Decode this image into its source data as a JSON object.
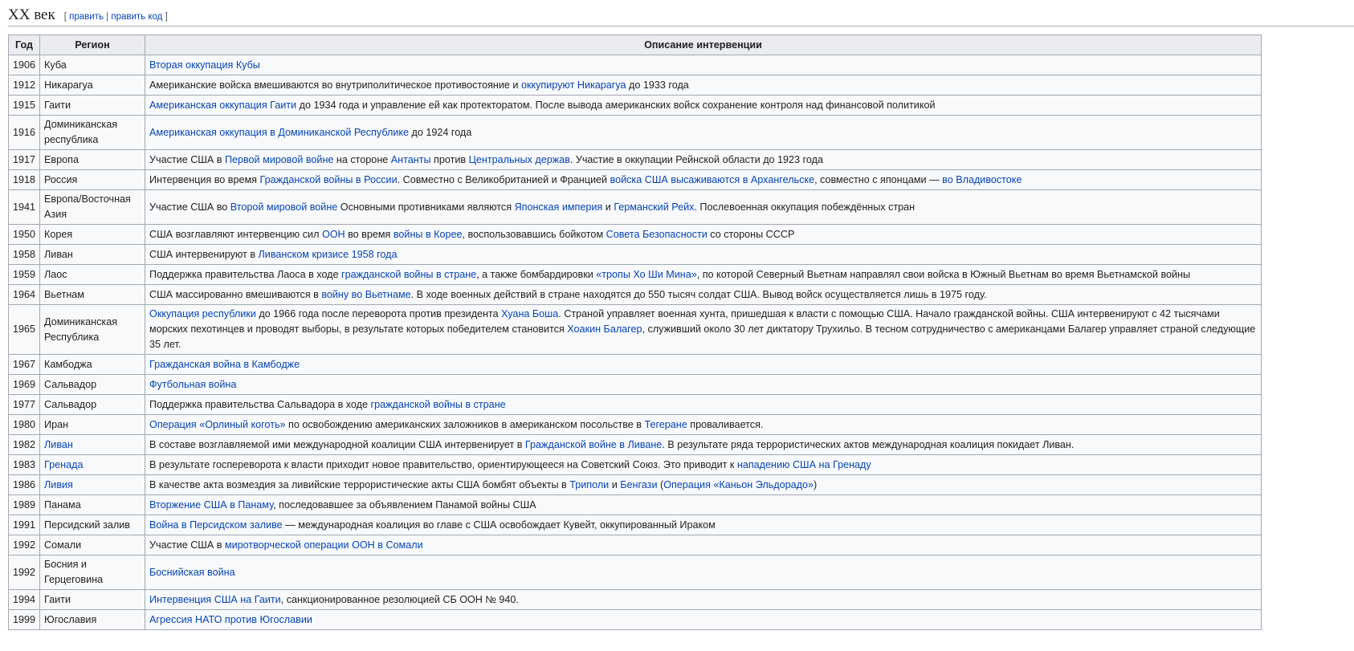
{
  "heading": {
    "title": "XX век",
    "edit_open": "[",
    "edit_label": "править",
    "edit_sep": "|",
    "edit_code_label": "править код",
    "edit_close": "]"
  },
  "table": {
    "headers": [
      "Год",
      "Регион",
      "Описание интервенции"
    ],
    "rows": [
      {
        "year": "1906",
        "region": {
          "text": "Куба",
          "link": false
        },
        "desc": [
          {
            "t": "Вторая оккупация Кубы",
            "l": true
          }
        ]
      },
      {
        "year": "1912",
        "region": {
          "text": "Никарагуа",
          "link": false
        },
        "desc": [
          {
            "t": "Американские войска вмешиваются во внутриполитическое противостояние и ",
            "l": false
          },
          {
            "t": "оккупируют Никарагуа",
            "l": true
          },
          {
            "t": " до 1933 года",
            "l": false
          }
        ]
      },
      {
        "year": "1915",
        "region": {
          "text": "Гаити",
          "link": false
        },
        "desc": [
          {
            "t": "Американская оккупация Гаити",
            "l": true
          },
          {
            "t": " до 1934 года и управление ей как протекторатом. После вывода американских войск сохранение контроля над финансовой политикой",
            "l": false
          }
        ]
      },
      {
        "year": "1916",
        "region": {
          "text": "Доминиканская республика",
          "link": false
        },
        "desc": [
          {
            "t": "Американская оккупация в Доминиканской Республике",
            "l": true
          },
          {
            "t": " до 1924 года",
            "l": false
          }
        ]
      },
      {
        "year": "1917",
        "region": {
          "text": "Европа",
          "link": false
        },
        "desc": [
          {
            "t": "Участие США в ",
            "l": false
          },
          {
            "t": "Первой мировой войне",
            "l": true
          },
          {
            "t": " на стороне ",
            "l": false
          },
          {
            "t": "Антанты",
            "l": true
          },
          {
            "t": " против ",
            "l": false
          },
          {
            "t": "Центральных держав",
            "l": true
          },
          {
            "t": ". Участие в оккупации Рейнской области до 1923 года",
            "l": false
          }
        ]
      },
      {
        "year": "1918",
        "region": {
          "text": "Россия",
          "link": false
        },
        "desc": [
          {
            "t": "Интервенция во время ",
            "l": false
          },
          {
            "t": "Гражданской войны в России",
            "l": true
          },
          {
            "t": ". Совместно с Великобританией и Францией ",
            "l": false
          },
          {
            "t": "войска США высаживаются в Архангельске",
            "l": true
          },
          {
            "t": ", совместно с японцами — ",
            "l": false
          },
          {
            "t": "во Владивостоке",
            "l": true
          }
        ]
      },
      {
        "year": "1941",
        "region": {
          "text": "Европа/Восточная Азия",
          "link": false
        },
        "desc": [
          {
            "t": "Участие США во ",
            "l": false
          },
          {
            "t": "Второй мировой войне",
            "l": true
          },
          {
            "t": " Основными противниками являются ",
            "l": false
          },
          {
            "t": "Японская империя",
            "l": true
          },
          {
            "t": " и ",
            "l": false
          },
          {
            "t": "Германский Рейх",
            "l": true
          },
          {
            "t": ". Послевоенная оккупация побеждённых стран",
            "l": false
          }
        ]
      },
      {
        "year": "1950",
        "region": {
          "text": "Корея",
          "link": false
        },
        "desc": [
          {
            "t": "США возглавляют интервенцию сил ",
            "l": false
          },
          {
            "t": "ООН",
            "l": true
          },
          {
            "t": " во время ",
            "l": false
          },
          {
            "t": "войны в Корее",
            "l": true
          },
          {
            "t": ", воспользовавшись бойкотом ",
            "l": false
          },
          {
            "t": "Совета Безопасности",
            "l": true
          },
          {
            "t": " со стороны СССР",
            "l": false
          }
        ]
      },
      {
        "year": "1958",
        "region": {
          "text": "Ливан",
          "link": false
        },
        "desc": [
          {
            "t": "США интервенируют в ",
            "l": false
          },
          {
            "t": "Ливанском кризисе 1958 года",
            "l": true
          }
        ]
      },
      {
        "year": "1959",
        "region": {
          "text": "Лаос",
          "link": false
        },
        "desc": [
          {
            "t": "Поддержка правительства Лаоса в ходе ",
            "l": false
          },
          {
            "t": "гражданской войны в стране",
            "l": true
          },
          {
            "t": ", а также бомбардировки ",
            "l": false
          },
          {
            "t": "«тропы Хо Ши Мина»",
            "l": true
          },
          {
            "t": ", по которой Северный Вьетнам направлял свои войска в Южный Вьетнам во время Вьетнамской войны",
            "l": false
          }
        ]
      },
      {
        "year": "1964",
        "region": {
          "text": "Вьетнам",
          "link": false
        },
        "desc": [
          {
            "t": "США массированно вмешиваются в ",
            "l": false
          },
          {
            "t": "войну во Вьетнаме",
            "l": true
          },
          {
            "t": ". В ходе военных действий в стране находятся до 550 тысяч солдат США. Вывод войск осуществляется лишь в 1975 году.",
            "l": false
          }
        ]
      },
      {
        "year": "1965",
        "region": {
          "text": "Доминиканская Республика",
          "link": false
        },
        "desc": [
          {
            "t": "Оккупация республики",
            "l": true
          },
          {
            "t": " до 1966 года после переворота против президента ",
            "l": false
          },
          {
            "t": "Хуана Боша",
            "l": true
          },
          {
            "t": ". Страной управляет военная хунта, пришедшая к власти с помощью США. Начало гражданской войны. США интервенируют с 42 тысячами морских пехотинцев и проводят выборы, в результате которых победителем становится ",
            "l": false
          },
          {
            "t": "Хоакин Балагер",
            "l": true
          },
          {
            "t": ", служивший около 30 лет диктатору Трухильо. В тесном сотрудничество с американцами Балагер управляет страной следующие 35 лет.",
            "l": false
          }
        ]
      },
      {
        "year": "1967",
        "region": {
          "text": "Камбоджа",
          "link": false
        },
        "desc": [
          {
            "t": "Гражданская война в Камбодже",
            "l": true
          }
        ]
      },
      {
        "year": "1969",
        "region": {
          "text": "Сальвадор",
          "link": false
        },
        "desc": [
          {
            "t": "Футбольная война",
            "l": true
          }
        ]
      },
      {
        "year": "1977",
        "region": {
          "text": "Сальвадор",
          "link": false
        },
        "desc": [
          {
            "t": "Поддержка правительства Сальвадора в ходе ",
            "l": false
          },
          {
            "t": "гражданской войны в стране",
            "l": true
          }
        ]
      },
      {
        "year": "1980",
        "region": {
          "text": "Иран",
          "link": false
        },
        "desc": [
          {
            "t": "Операция «Орлиный коготь»",
            "l": true
          },
          {
            "t": " по освобождению американских заложников в американском посольстве в ",
            "l": false
          },
          {
            "t": "Тегеране",
            "l": true
          },
          {
            "t": " проваливается.",
            "l": false
          }
        ]
      },
      {
        "year": "1982",
        "region": {
          "text": "Ливан",
          "link": true
        },
        "desc": [
          {
            "t": "В составе возглавляемой ими международной коалиции США интервенирует в ",
            "l": false
          },
          {
            "t": "Гражданской войне в Ливане",
            "l": true
          },
          {
            "t": ". В результате ряда террористических актов международная коалиция покидает Ливан.",
            "l": false
          }
        ]
      },
      {
        "year": "1983",
        "region": {
          "text": "Гренада",
          "link": true
        },
        "desc": [
          {
            "t": "В результате госпереворота к власти приходит новое правительство, ориентирующееся на Советский Союз. Это приводит к ",
            "l": false
          },
          {
            "t": "нападению США на Гренаду",
            "l": true
          }
        ]
      },
      {
        "year": "1986",
        "region": {
          "text": "Ливия",
          "link": true
        },
        "desc": [
          {
            "t": "В качестве акта возмездия за ливийские террористические акты США бомбят объекты в ",
            "l": false
          },
          {
            "t": "Триполи",
            "l": true
          },
          {
            "t": " и ",
            "l": false
          },
          {
            "t": "Бенгази",
            "l": true
          },
          {
            "t": " (",
            "l": false
          },
          {
            "t": "Операция «Каньон Эльдорадо»",
            "l": true
          },
          {
            "t": ")",
            "l": false
          }
        ]
      },
      {
        "year": "1989",
        "region": {
          "text": "Панама",
          "link": false
        },
        "desc": [
          {
            "t": "Вторжение США в Панаму",
            "l": true
          },
          {
            "t": ", последовавшее за объявлением Панамой войны США",
            "l": false
          }
        ]
      },
      {
        "year": "1991",
        "region": {
          "text": "Персидский залив",
          "link": false
        },
        "desc": [
          {
            "t": "Война в Персидском заливе",
            "l": true
          },
          {
            "t": " — международная коалиция во главе с США освобождает Кувейт, оккупированный Ираком",
            "l": false
          }
        ]
      },
      {
        "year": "1992",
        "region": {
          "text": "Сомали",
          "link": false
        },
        "desc": [
          {
            "t": "Участие США в ",
            "l": false
          },
          {
            "t": "миротворческой операции ООН в Сомали",
            "l": true
          }
        ]
      },
      {
        "year": "1992",
        "region": {
          "text": "Босния и Герцеговина",
          "link": false
        },
        "desc": [
          {
            "t": "Боснийская война",
            "l": true
          }
        ]
      },
      {
        "year": "1994",
        "region": {
          "text": "Гаити",
          "link": false
        },
        "desc": [
          {
            "t": "Интервенция США на Гаити",
            "l": true
          },
          {
            "t": ", санкционированное резолюцией СБ ООН № 940.",
            "l": false
          }
        ]
      },
      {
        "year": "1999",
        "region": {
          "text": "Югославия",
          "link": false
        },
        "desc": [
          {
            "t": "Агрессия НАТО против Югославии",
            "l": true
          }
        ]
      }
    ]
  }
}
